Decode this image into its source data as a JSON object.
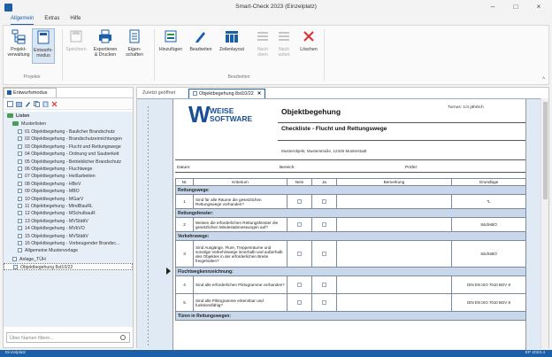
{
  "window": {
    "title": "Smart-Check 2023 (Einzelplatz)",
    "controls": [
      "–",
      "□",
      "×"
    ]
  },
  "menu": {
    "items": [
      {
        "label": "Allgemein",
        "active": true
      },
      {
        "label": "Extras",
        "active": false
      },
      {
        "label": "Hilfe",
        "active": false
      }
    ]
  },
  "ribbon": {
    "projekte_group": "Projekte",
    "bearbeiten_group": "Bearbeiten",
    "buttons": {
      "projektverwaltung": "Projekt-\nverwaltung",
      "entwurfsmodus": "Entwurfs-\nmodus",
      "speichern": "Speichern",
      "exportieren": "Exportieren\n& Drucken",
      "eigenschaften": "Eigen-\nschaften",
      "hinzufuegen": "Hinzufügen",
      "bearbeiten": "Bearbeiten",
      "zeilenlayout": "Zeilenlayout",
      "nach_oben": "Nach\noben",
      "nach_unten": "Nach\nunten",
      "loeschen": "Löschen"
    }
  },
  "left_panel": {
    "tab_label": "Entwurfsmodus",
    "tree": {
      "root": "Listen",
      "folder": "Musterlisten",
      "items": [
        "01 Objektbegehung - Baulicher Brandschutz",
        "02 Objektbegehung - Brandschutzeinrichtungen",
        "03 Objektbegehung - Flucht und Rettungswege",
        "04 Objektbegehung - Ordnung und Sauberkeit",
        "05 Objektbegehung - Betrieblicher Brandschutz",
        "06 Objektbegehung - Fluchtwege",
        "07 Objektbegehung - Heißarbeiten",
        "08 Objektbegehung - HBeV",
        "09 Objektbegehung - MBO",
        "10 Objektbegehung - MGarV",
        "11 Objektbegehung - MIndBauRL",
        "12 Objektbegehung - MSchulbauR",
        "13 Objektbegehung - MVStättV",
        "14 Objektbegehung - MVkVO",
        "15 Objektbegehung - MVStättV",
        "16 Objektbegehung - Vorbeugender Brandsc...",
        "Allgemeine Mustervorlage"
      ],
      "extra_items": [
        "Anlage_TÜH",
        "Objektbegehung 8st10/22"
      ]
    },
    "search_placeholder": "Über Namen filtern..."
  },
  "main": {
    "tabs": [
      {
        "label": "Zuletzt geöffnet",
        "active": false
      },
      {
        "label": "Objektbegehung 8st10/22",
        "active": true
      }
    ],
    "document": {
      "logo_line1": "WEISE",
      "logo_line2": "SOFTWARE",
      "title": "Objektbegehung",
      "turnus": "Turnus: 1/4 jährlich",
      "subtitle": "Checkliste - Flucht und Rettungswege",
      "address": "Musterobjekt, Musterstraße, 12345 Musterstadt",
      "meta": {
        "datum": "Datum:",
        "bereich": "Bereich:",
        "pruefer": "Prüfer:"
      },
      "columns": [
        "Nr.",
        "Kriterium",
        "Nein",
        "Ja",
        "Bemerkung",
        "Grundlage"
      ],
      "sections": [
        {
          "title": "Rettungswege:",
          "rows": [
            {
              "nr": "1",
              "kriterium": "Sind für alle Räume die gesetzlichen Rettungswege vorhanden?",
              "grundlage": "*L"
            }
          ]
        },
        {
          "title": "Rettungsfenster:",
          "rows": [
            {
              "nr": "2",
              "kriterium": "Weisen die erforderlichen Rettungsfenster die gesetzlichen Mindestabmessungen auf?",
              "grundlage": "SächsBO"
            }
          ]
        },
        {
          "title": "Verkehrswege:",
          "rows": [
            {
              "nr": "3",
              "kriterium": "Sind Ausgänge, Flure, Treppenräume und sonstige Verkehrswege innerhalb und außerhalb des Objektes in der erforderlichen Breite freigehalten?",
              "grundlage": "SächsBO"
            }
          ]
        },
        {
          "title": "Fluchtwegkennzeichnung:",
          "rows": [
            {
              "nr": "4",
              "kriterium": "Sind alle erforderlichen Piktogramme vorhanden?",
              "grundlage": "DIN EN ISO 7010 BGV 8"
            },
            {
              "nr": "5",
              "kriterium": "Sind alle Piktogramme erkennbar und funktionsfähig?",
              "grundlage": "DIN EN ISO 7010 BGV 8"
            }
          ]
        },
        {
          "title": "Türen in Rettungswegen:",
          "rows": []
        }
      ]
    }
  },
  "status": {
    "left": "Einzelplatz",
    "right": "EP 2023.4"
  },
  "colors": {
    "accent": "#1b5fa8",
    "section_bg": "#c8d8ea",
    "tree_bg": "#e6eef7",
    "delete_red": "#d83030"
  }
}
